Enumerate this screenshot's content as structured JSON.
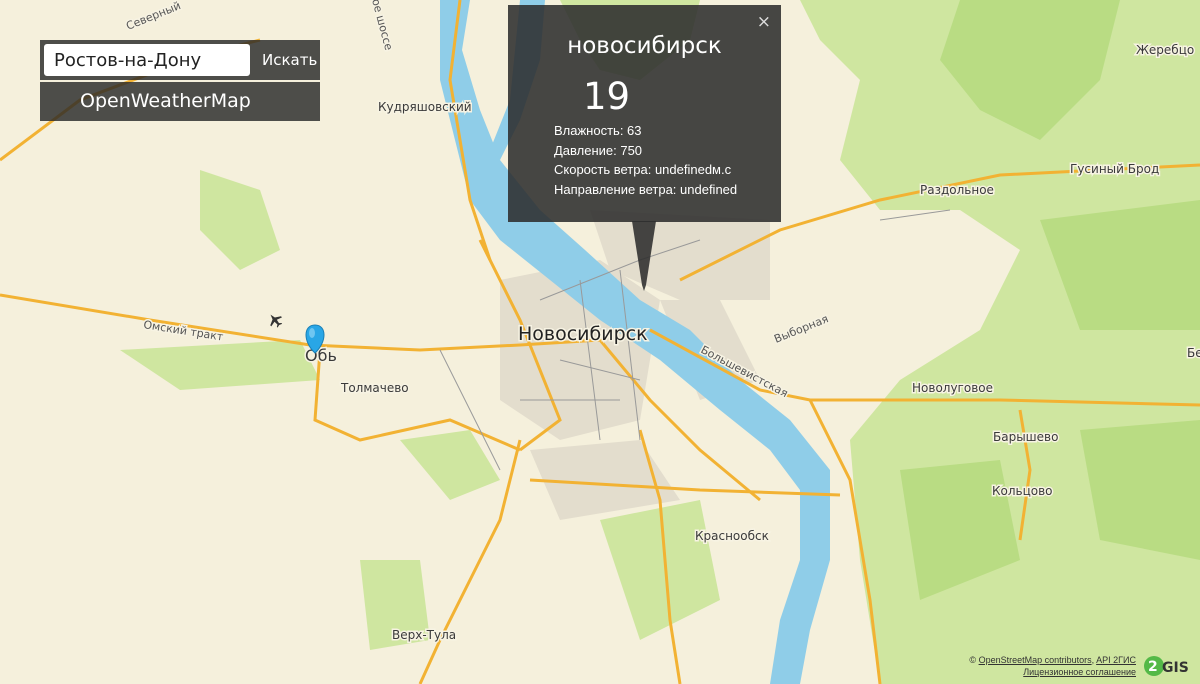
{
  "search": {
    "value": "Ростов-на-Дону",
    "button_label": "Искать"
  },
  "brand": {
    "label": "OpenWeatherMap"
  },
  "popup": {
    "close": "×",
    "city": "новосибирск",
    "temperature": "19",
    "humidity": "Влажность: 63",
    "pressure": "Давление: 750",
    "wind_speed": "Скорость ветра: undefinedм.с",
    "wind_direction": "Направление ветра: undefined"
  },
  "map": {
    "labels": {
      "novosibirsk": "Новосибирск",
      "ob": "Обь",
      "tolmachevo": "Толмачево",
      "kudryashovsky": "Кудряшовский",
      "razdolnoe": "Раздольное",
      "gusiny_brod": "Гусиный Брод",
      "zherebtsovo": "Жеребцо",
      "novolugovoe": "Новолуговое",
      "baryshevo": "Барышево",
      "koltsovo": "Кольцово",
      "krasnoobsk": "Краснообск",
      "verkh_tula": "Верх-Тула",
      "omsky_trakt": "Омский тракт",
      "vybornaya": "Выборная",
      "bolshevistskaya": "Большевистская",
      "severny": "Северный",
      "shosse": "ое шоссе",
      "be": "Бе"
    },
    "colors": {
      "land": "#f5f0dc",
      "forest": "#cfe6a0",
      "water": "#8fcde8",
      "road": "#f2b233",
      "urban": "#e3ddcd"
    },
    "marker_icon": "map-pin-icon",
    "airport_icon": "airplane-icon"
  },
  "attribution": {
    "prefix": "© ",
    "osm_link": "OpenStreetMap contributors",
    "separator": ", ",
    "api_link": "API 2ГИС",
    "license_link": "Лицензионное соглашение"
  },
  "logo": {
    "text": "2GIS"
  }
}
